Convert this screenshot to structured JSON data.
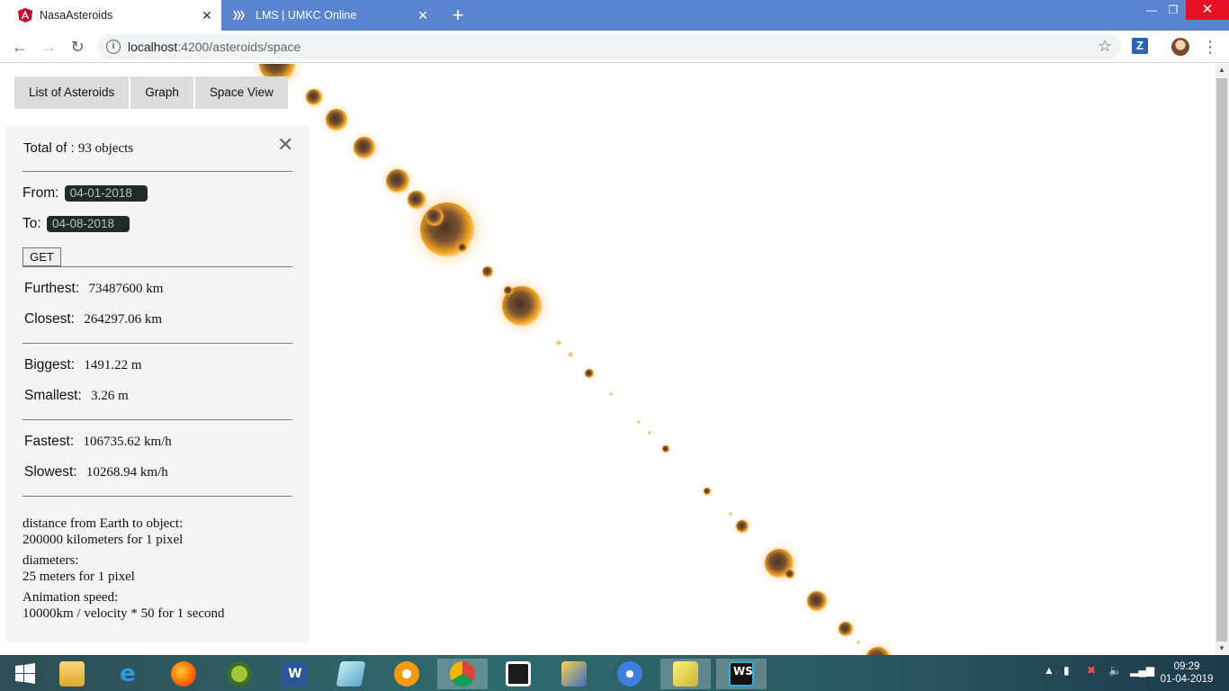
{
  "browser": {
    "tabs": [
      {
        "title": "NasaAsteroids",
        "active": true,
        "icon": "angular-icon"
      },
      {
        "title": "LMS | UMKC Online",
        "active": false,
        "icon": "lms-icon"
      }
    ],
    "url_host": "localhost",
    "url_path": ":4200/asteroids/space",
    "extension": "Z"
  },
  "nav": {
    "tabs": [
      "List of Asteroids",
      "Graph",
      "Space View"
    ]
  },
  "panel": {
    "total_label": "Total of :",
    "total_value": "93 objects",
    "from_label": "From:",
    "from_value": "04-01-2018",
    "to_label": "To:",
    "to_value": "04-08-2018",
    "get_label": "GET",
    "furthest_label": "Furthest:",
    "furthest_value": "73487600 km",
    "closest_label": "Closest:",
    "closest_value": "264297.06 km",
    "biggest_label": "Biggest:",
    "biggest_value": "1491.22 m",
    "smallest_label": "Smallest:",
    "smallest_value": "3.26 m",
    "fastest_label": "Fastest:",
    "fastest_value": "106735.62 km/h",
    "slowest_label": "Slowest:",
    "slowest_value": "10268.94 km/h",
    "note_distance_title": "distance from Earth to object:",
    "note_distance_text": "200000 kilometers for 1 pixel",
    "note_diameter_title": "diameters:",
    "note_diameter_text": "25 meters for 1 pixel",
    "note_speed_title": "Animation speed:",
    "note_speed_text": "10000km / velocity * 50 for 1 second"
  },
  "taskbar": {
    "time": "09:29",
    "date": "01-04-2019"
  },
  "colors": {
    "tab_strip": "#5a84d0",
    "asteroid_core": "#4a3324",
    "asteroid_glow": "#f5a623"
  }
}
